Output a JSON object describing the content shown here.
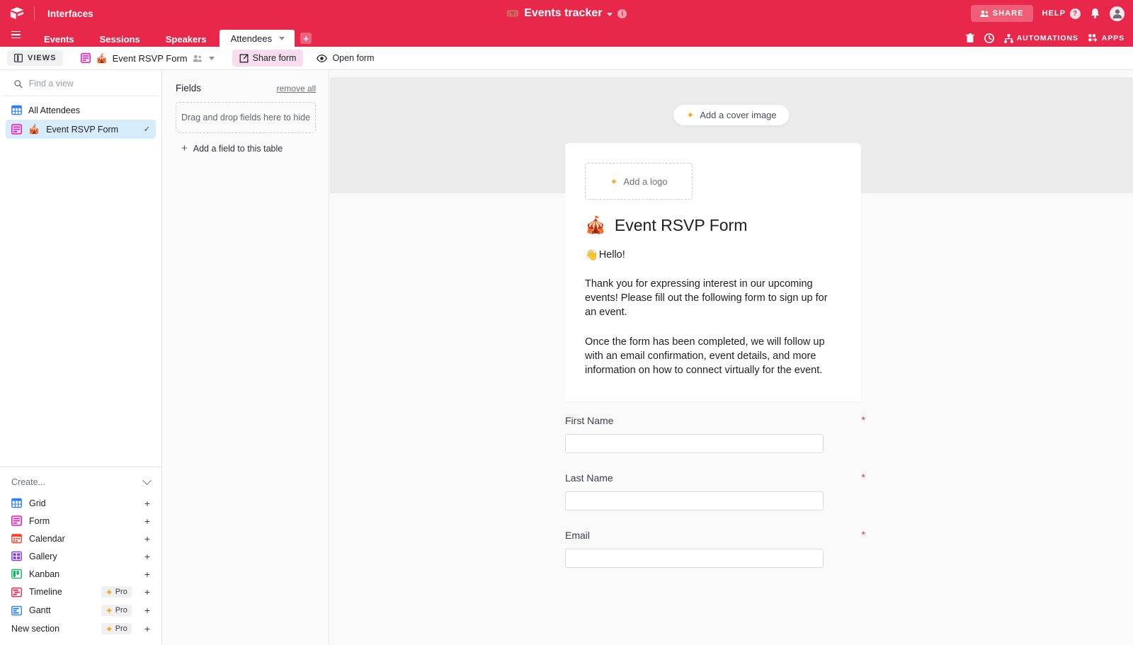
{
  "header": {
    "app_name": "Interfaces",
    "base_title": "Events tracker",
    "base_emoji": "🎟️",
    "share_label": "SHARE",
    "help_label": "HELP",
    "help_mark": "?",
    "info_mark": "i"
  },
  "tabs": {
    "items": [
      {
        "label": "Events",
        "active": false
      },
      {
        "label": "Sessions",
        "active": false
      },
      {
        "label": "Speakers",
        "active": false
      },
      {
        "label": "Attendees",
        "active": true
      }
    ],
    "add_tab_label": "+",
    "right_items": [
      {
        "label": "",
        "icon": "trash-icon"
      },
      {
        "label": "",
        "icon": "history-icon"
      },
      {
        "label": "AUTOMATIONS",
        "icon": "automations-icon"
      },
      {
        "label": "APPS",
        "icon": "apps-icon"
      }
    ]
  },
  "toolbar": {
    "views_label": "VIEWS",
    "current_view": "Event RSVP Form",
    "current_view_emoji": "🎪",
    "share_form_label": "Share form",
    "open_form_label": "Open form"
  },
  "sidebar": {
    "search_placeholder": "Find a view",
    "search_value": "",
    "views": [
      {
        "label": "All Attendees",
        "emoji": "",
        "selected": false,
        "icon_color": "#2D7FF9"
      },
      {
        "label": "Event RSVP Form",
        "emoji": "🎪",
        "selected": true,
        "icon_color": "#FF08C2"
      }
    ],
    "check_glyph": "✓",
    "create": {
      "title": "Create...",
      "items": [
        {
          "label": "Grid",
          "icon_color": "#2D7FF9",
          "pro": false
        },
        {
          "label": "Form",
          "icon_color": "#FF08C2",
          "pro": false
        },
        {
          "label": "Calendar",
          "icon_color": "#FF3F2E",
          "pro": false
        },
        {
          "label": "Gallery",
          "icon_color": "#7C37EF",
          "pro": false
        },
        {
          "label": "Kanban",
          "icon_color": "#14B560",
          "pro": false
        },
        {
          "label": "Timeline",
          "icon_color": "#E8284A",
          "pro": true
        },
        {
          "label": "Gantt",
          "icon_color": "#2D7FF9",
          "pro": true
        },
        {
          "label": "New section",
          "icon_color": "",
          "pro": true
        }
      ],
      "pro_label": "Pro",
      "plus_label": "+"
    }
  },
  "fields_panel": {
    "title": "Fields",
    "remove_all_label": "remove all",
    "drop_zone_text": "Drag and drop fields here to hide",
    "add_field_label": "Add a field to this table",
    "add_field_plus": "+"
  },
  "form": {
    "add_cover_label": "Add a cover image",
    "add_logo_label": "Add a logo",
    "title": "Event RSVP Form",
    "title_emoji": "🎪",
    "hello_emoji": "👋",
    "hello_text": "Hello!",
    "paragraph_1": "Thank you for expressing interest in our upcoming events! Please fill out the following form to sign up for an event.",
    "paragraph_2": "Once the form has been completed, we will follow up with an email confirmation, event details, and more information on how to connect virtually for the event.",
    "fields": [
      {
        "label": "First Name",
        "value": "",
        "required": true,
        "required_mark": "*"
      },
      {
        "label": "Last Name",
        "value": "",
        "required": true,
        "required_mark": "*"
      },
      {
        "label": "Email",
        "value": "",
        "required": true,
        "required_mark": "*"
      }
    ]
  },
  "colors": {
    "brand_red": "#E8284A",
    "form_pink": "#FF08C2",
    "share_form_bg": "#FADCEF",
    "selected_view_bg": "#D8EDFB",
    "canvas_bg": "#FAFAFA",
    "cover_bg": "#EBEBEB",
    "required_star": "#E8284A",
    "sparkle_orange": "#F5A623"
  }
}
